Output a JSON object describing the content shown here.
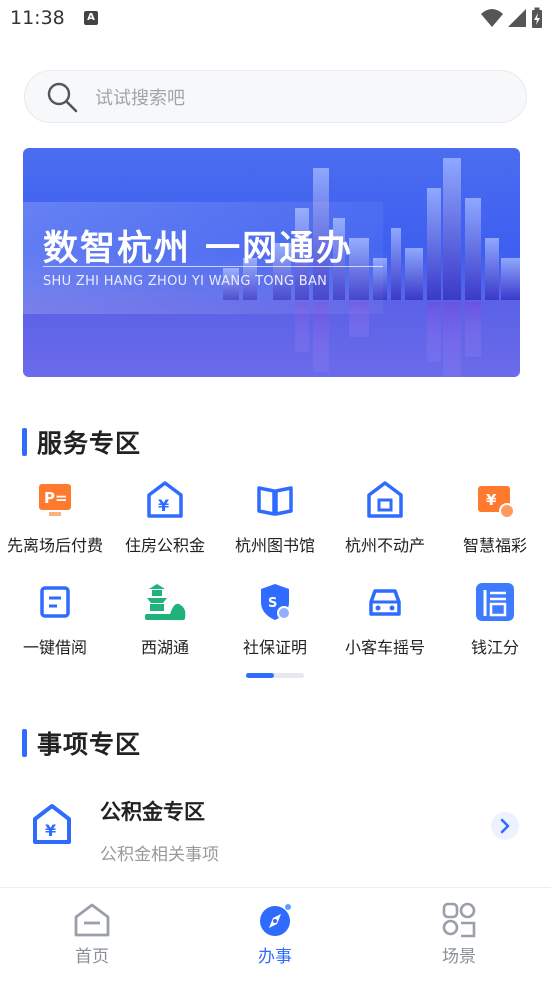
{
  "status": {
    "time": "11:38",
    "a_badge": "A"
  },
  "search": {
    "placeholder": "试试搜索吧"
  },
  "banner": {
    "title": "数智杭州 一网通办",
    "subtitle": "SHU ZHI HANG ZHOU   YI WANG TONG BAN"
  },
  "services": {
    "title": "服务专区",
    "items": [
      {
        "label": "先离场后付费",
        "icon": "parking-pay-icon"
      },
      {
        "label": "住房公积金",
        "icon": "housing-fund-icon"
      },
      {
        "label": "杭州图书馆",
        "icon": "library-book-icon"
      },
      {
        "label": "杭州不动产",
        "icon": "real-estate-icon"
      },
      {
        "label": "智慧福彩",
        "icon": "lottery-ticket-icon"
      },
      {
        "label": "一键借阅",
        "icon": "borrow-book-icon"
      },
      {
        "label": "西湖通",
        "icon": "west-lake-pagoda-icon"
      },
      {
        "label": "社保证明",
        "icon": "social-security-icon"
      },
      {
        "label": "小客车摇号",
        "icon": "car-lottery-icon"
      },
      {
        "label": "钱江分",
        "icon": "credit-score-icon"
      }
    ]
  },
  "matters": {
    "title": "事项专区",
    "item": {
      "title": "公积金专区",
      "subtitle": "公积金相关事项"
    }
  },
  "tabbar": {
    "home": "首页",
    "affairs": "办事",
    "scenes": "场景",
    "active": "办事"
  },
  "colors": {
    "accent": "#2f6bff",
    "icon_orange": "#ff7a2f",
    "icon_blue": "#2f6bff",
    "icon_green": "#1fb37a"
  }
}
